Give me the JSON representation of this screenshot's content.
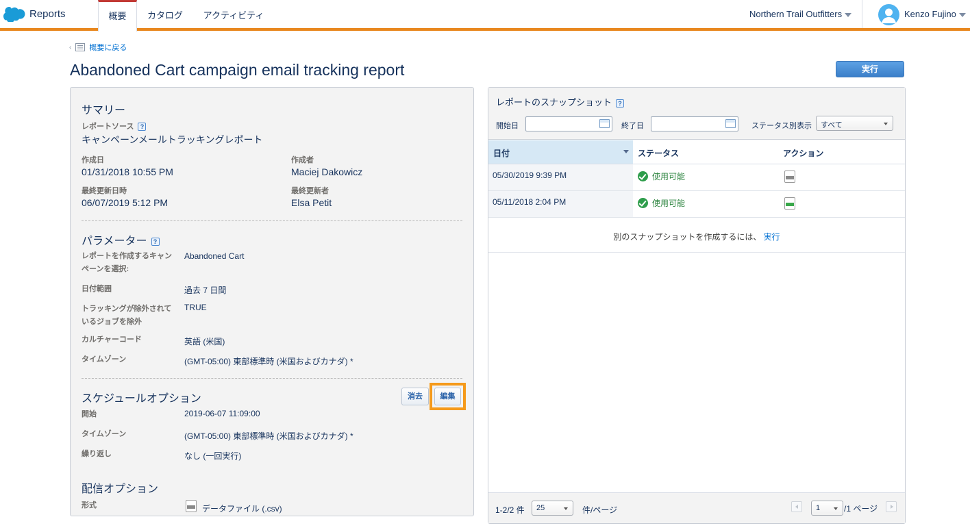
{
  "app": {
    "name": "Reports"
  },
  "tabs": [
    {
      "label": "概要"
    },
    {
      "label": "カタログ"
    },
    {
      "label": "アクティビティ"
    }
  ],
  "header": {
    "org": "Northern Trail Outfitters",
    "user": "Kenzo Fujino"
  },
  "page": {
    "back_label": "概要に戻る",
    "title": "Abandoned Cart campaign email tracking report",
    "run_label": "実行"
  },
  "summary": {
    "title": "サマリー",
    "source_label": "レポートソース",
    "source_value": "キャンペーンメールトラッキングレポート",
    "created_label": "作成日",
    "created_value": "01/31/2018 10:55 PM",
    "creator_label": "作成者",
    "creator_value": "Maciej Dakowicz",
    "modified_label": "最終更新日時",
    "modified_value": "06/07/2019 5:12 PM",
    "modifier_label": "最終更新者",
    "modifier_value": "Elsa Petit"
  },
  "parameters": {
    "title": "パラメーター",
    "rows": [
      {
        "label_l1": "レポートを作成するキャン",
        "label_l2": "ペーンを選択:",
        "value": "Abandoned Cart"
      },
      {
        "label_l1": "日付範囲",
        "label_l2": "",
        "value": "過去 7 日間"
      },
      {
        "label_l1": "トラッキングが除外されて",
        "label_l2": "いるジョブを除外",
        "value": "TRUE"
      },
      {
        "label_l1": "カルチャーコード",
        "label_l2": "",
        "value": "英語 (米国)"
      },
      {
        "label_l1": "タイムゾーン",
        "label_l2": "",
        "value": "(GMT-05:00) 東部標準時 (米国およびカナダ) *"
      }
    ]
  },
  "schedule": {
    "title": "スケジュールオプション",
    "clear_label": "消去",
    "edit_label": "編集",
    "rows": [
      {
        "label": "開始",
        "value": "2019-06-07 11:09:00"
      },
      {
        "label": "タイムゾーン",
        "value": "(GMT-05:00) 東部標準時 (米国およびカナダ) *"
      },
      {
        "label": "繰り返し",
        "value": "なし (一回実行)"
      }
    ]
  },
  "delivery": {
    "title": "配信オプション",
    "format_label": "形式",
    "format_value": "データファイル (.csv)"
  },
  "snapshots": {
    "title": "レポートのスナップショット",
    "start_label": "開始日",
    "end_label": "終了日",
    "status_filter_label": "ステータス別表示",
    "status_filter_value": "すべて",
    "columns": {
      "date": "日付",
      "status": "ステータス",
      "action": "アクション"
    },
    "rows": [
      {
        "date": "05/30/2019 9:39 PM",
        "status": "使用可能"
      },
      {
        "date": "05/11/2018 2:04 PM",
        "status": "使用可能"
      }
    ],
    "create_prompt": "別のスナップショットを作成するには、",
    "create_link": "実行"
  },
  "pagination": {
    "range": "1-2/2 件",
    "per_page": "25",
    "per_page_suffix": "件/ページ",
    "page": "1",
    "page_suffix": "/1 ページ"
  }
}
